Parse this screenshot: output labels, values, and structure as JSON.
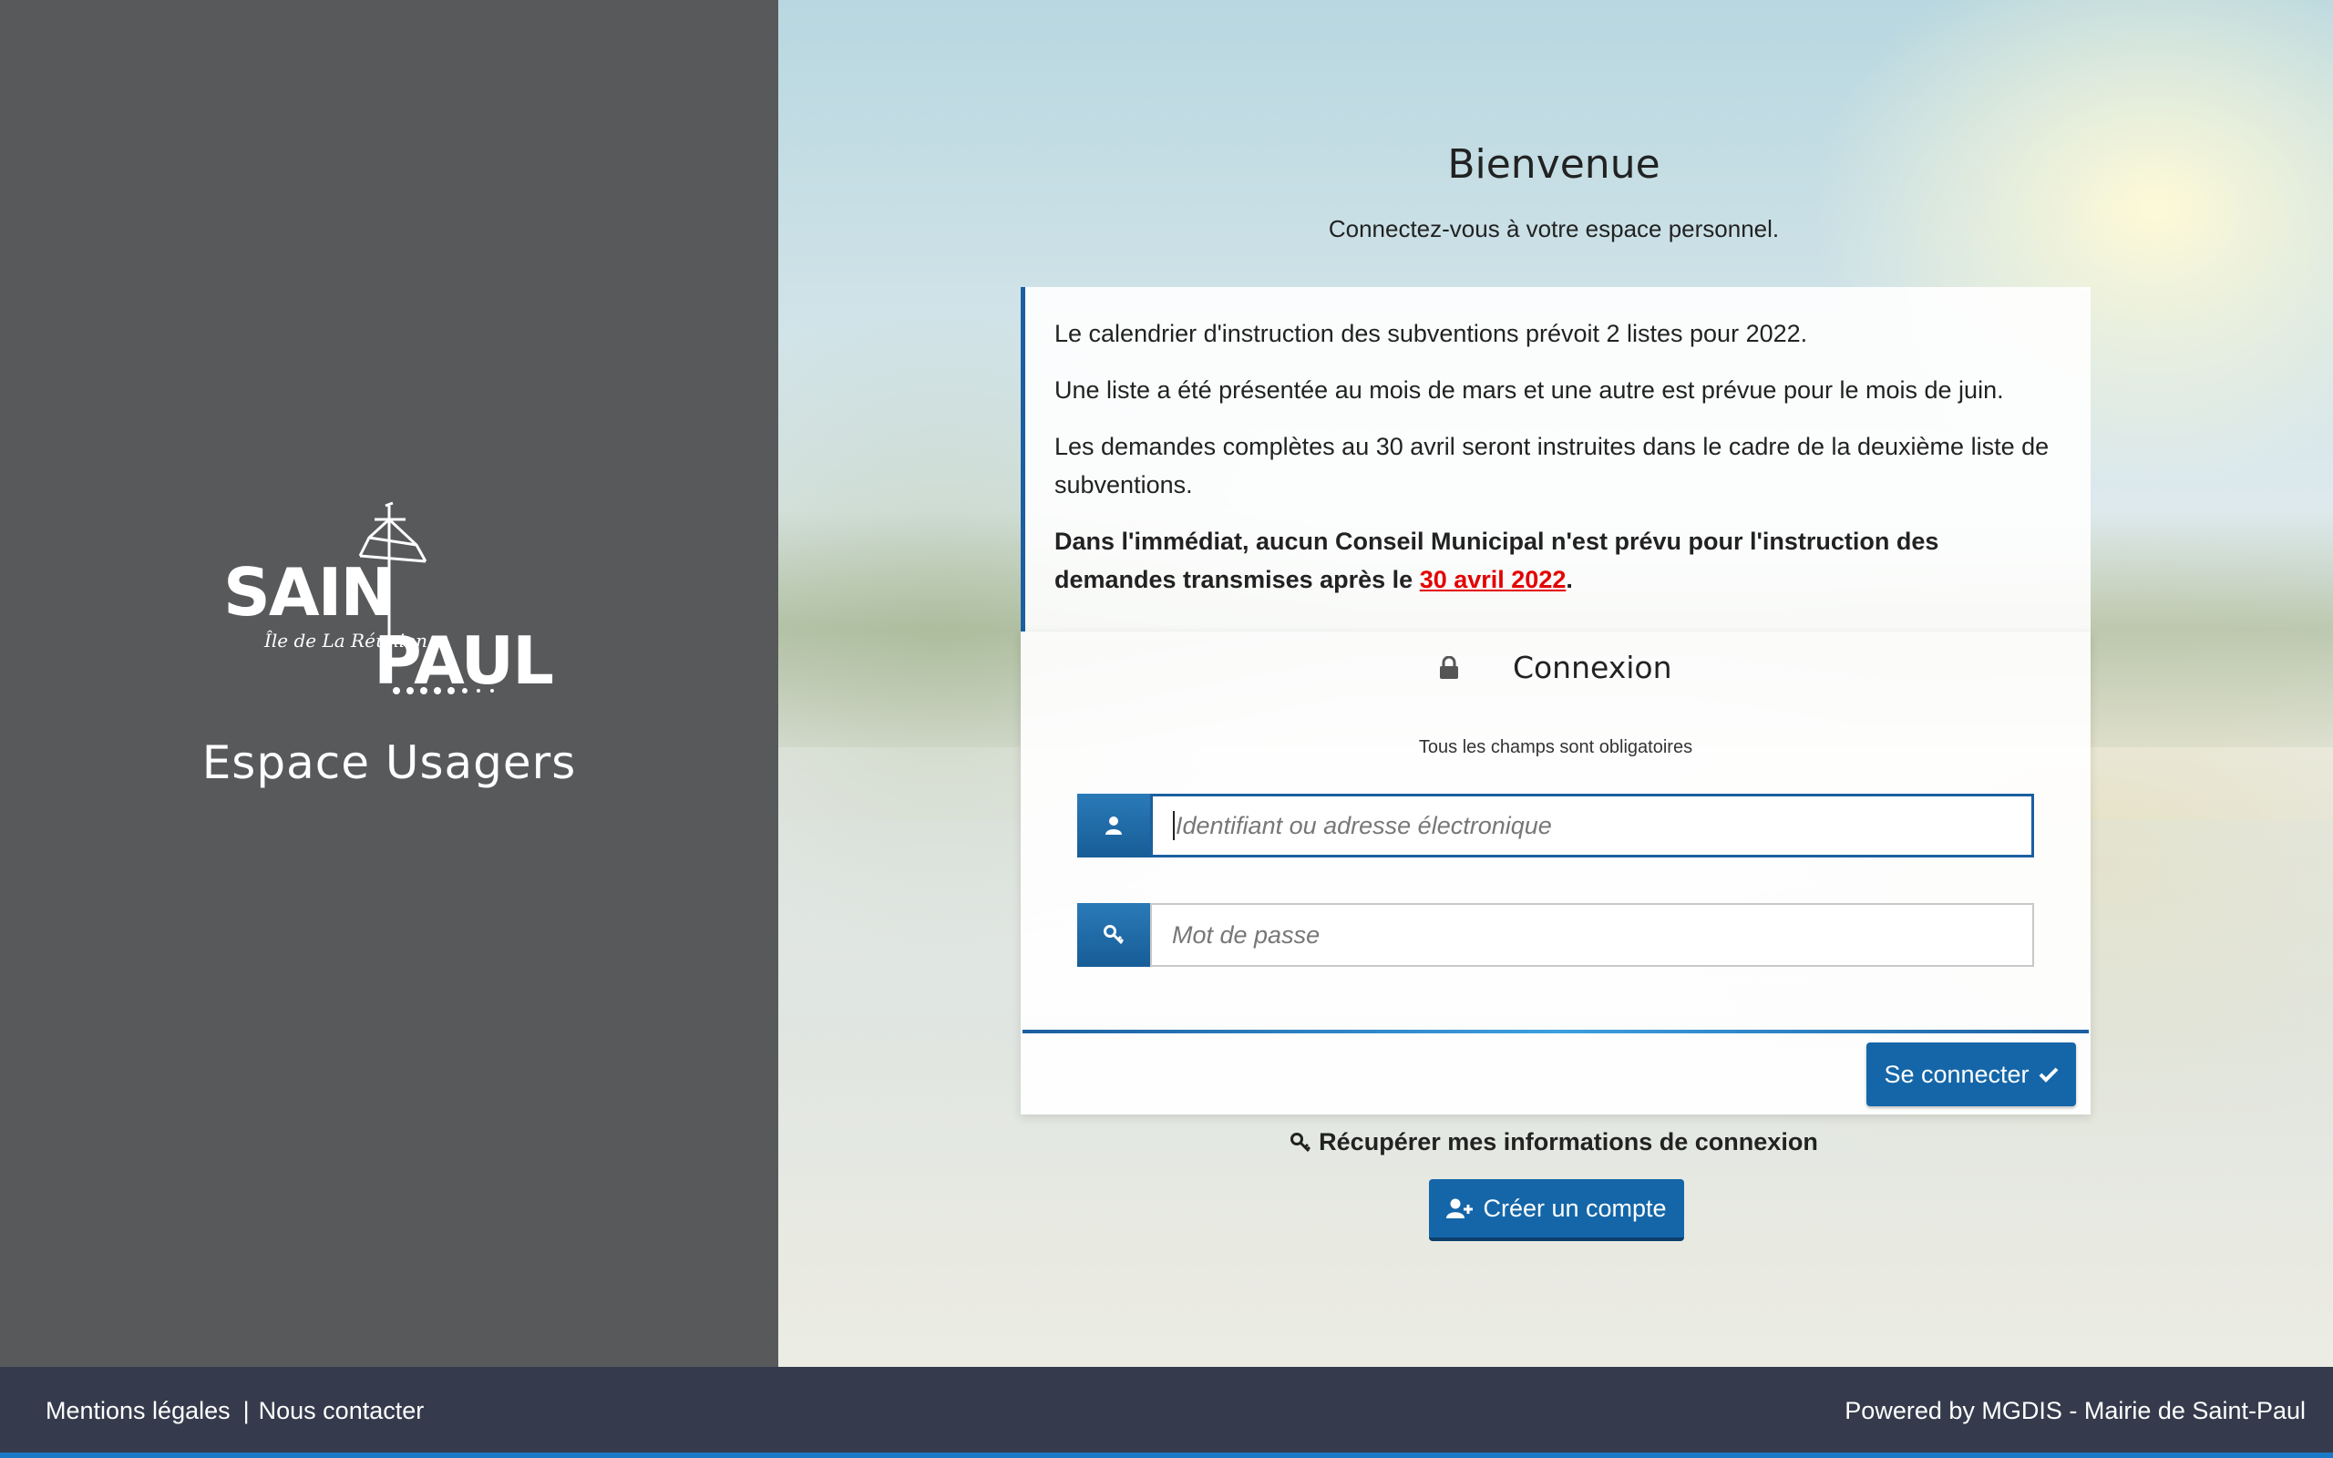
{
  "sidebar": {
    "logo_text": "SAINT PAUL",
    "logo_subtext": "Île de La Réunion",
    "title": "Espace Usagers"
  },
  "welcome": {
    "title": "Bienvenue",
    "subtitle": "Connectez-vous à votre espace personnel."
  },
  "info": {
    "p1": "Le calendrier d'instruction des subventions prévoit 2 listes pour 2022.",
    "p2": "Une liste a été présentée au mois de mars et une autre est prévue pour le mois de juin.",
    "p3": "Les demandes complètes au 30 avril seront instruites dans le cadre de la deuxième liste de subventions.",
    "p4_bold": "Dans l'immédiat, aucun Conseil Municipal n'est prévu pour l'instruction des demandes transmises après le ",
    "p4_link": "30 avril 2022",
    "p4_end": "."
  },
  "login": {
    "title": "Connexion",
    "required_note": "Tous les champs sont obligatoires",
    "username_placeholder": "Identifiant ou adresse électronique",
    "password_placeholder": "Mot de passe",
    "submit_label": "Se connecter"
  },
  "links": {
    "recover": "Récupérer mes informations de connexion",
    "create_account": "Créer un compte"
  },
  "footer": {
    "legal": "Mentions légales",
    "separator": "|",
    "contact": "Nous contacter",
    "powered": "Powered by MGDIS - Mairie de Saint-Paul"
  },
  "colors": {
    "accent": "#1466a8",
    "sidebar_bg": "#58595b",
    "footer_bg": "#353b4c",
    "alert_red": "#e30000"
  },
  "icons": {
    "lock": "lock-icon",
    "user": "user-icon",
    "key": "key-icon",
    "check": "check-icon",
    "add_user": "add-user-icon"
  }
}
